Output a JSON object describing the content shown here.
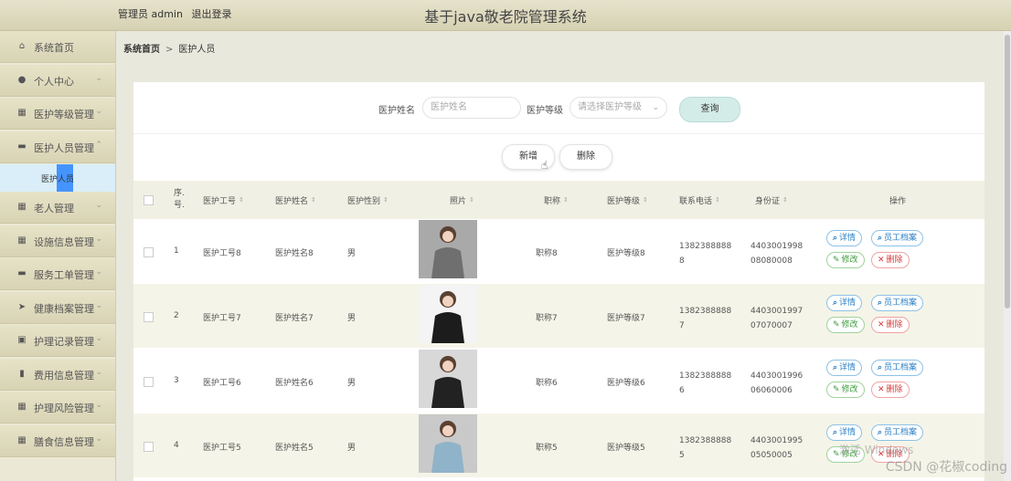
{
  "header": {
    "user_role": "管理员 admin",
    "logout": "退出登录",
    "title": "基于java敬老院管理系统"
  },
  "sidebar": {
    "items": [
      {
        "label": "系统首页",
        "icon": "home-icon",
        "glyph": "⌂",
        "expandable": false
      },
      {
        "label": "个人中心",
        "icon": "user-icon",
        "glyph": "●",
        "expandable": true
      },
      {
        "label": "医护等级管理",
        "icon": "grid-icon",
        "glyph": "▦",
        "expandable": true
      },
      {
        "label": "医护人员管理",
        "icon": "chat-icon",
        "glyph": "▬",
        "expandable": true,
        "expanded": true,
        "sub": [
          {
            "label": "医护人员"
          }
        ]
      },
      {
        "label": "老人管理",
        "icon": "grid-icon",
        "glyph": "▦",
        "expandable": true
      },
      {
        "label": "设施信息管理",
        "icon": "grid-icon",
        "glyph": "▦",
        "expandable": true
      },
      {
        "label": "服务工单管理",
        "icon": "monitor-icon",
        "glyph": "▬",
        "expandable": true
      },
      {
        "label": "健康档案管理",
        "icon": "send-icon",
        "glyph": "➤",
        "expandable": true
      },
      {
        "label": "护理记录管理",
        "icon": "doc-icon",
        "glyph": "▣",
        "expandable": true
      },
      {
        "label": "费用信息管理",
        "icon": "bar-chart-icon",
        "glyph": "▮",
        "expandable": true
      },
      {
        "label": "护理风险管理",
        "icon": "grid-icon",
        "glyph": "▦",
        "expandable": true
      },
      {
        "label": "膳食信息管理",
        "icon": "grid-icon",
        "glyph": "▦",
        "expandable": true
      }
    ]
  },
  "breadcrumb": {
    "home": "系统首页",
    "separator": ">",
    "current": "医护人员"
  },
  "search": {
    "name_label": "医护姓名",
    "name_placeholder": "医护姓名",
    "level_label": "医护等级",
    "level_placeholder": "请选择医护等级",
    "query_button": "查询"
  },
  "actions": {
    "add_button": "新增",
    "delete_button": "删除"
  },
  "table": {
    "columns": [
      "序号",
      "医护工号",
      "医护姓名",
      "医护性别",
      "照片",
      "职称",
      "医护等级",
      "联系电话",
      "身份证",
      "操作"
    ],
    "col_index_line1": "序.",
    "col_index_line2": "号.",
    "rows": [
      {
        "index": "1",
        "id": "医护工号8",
        "name": "医护姓名8",
        "gender": "男",
        "title": "职称8",
        "level": "医护等级8",
        "phone1": "1382388888",
        "phone2": "8",
        "idcard1": "4403001998",
        "idcard2": "08080008"
      },
      {
        "index": "2",
        "id": "医护工号7",
        "name": "医护姓名7",
        "gender": "男",
        "title": "职称7",
        "level": "医护等级7",
        "phone1": "1382388888",
        "phone2": "7",
        "idcard1": "4403001997",
        "idcard2": "07070007"
      },
      {
        "index": "3",
        "id": "医护工号6",
        "name": "医护姓名6",
        "gender": "男",
        "title": "职称6",
        "level": "医护等级6",
        "phone1": "1382388888",
        "phone2": "6",
        "idcard1": "4403001996",
        "idcard2": "06060006"
      },
      {
        "index": "4",
        "id": "医护工号5",
        "name": "医护姓名5",
        "gender": "男",
        "title": "职称5",
        "level": "医护等级5",
        "phone1": "1382388888",
        "phone2": "5",
        "idcard1": "4403001995",
        "idcard2": "05050005"
      }
    ],
    "ops": {
      "detail": "详情",
      "archive": "员工档案",
      "edit": "修改",
      "delete": "删除"
    }
  },
  "overlay": {
    "activate": "激活 Windows",
    "watermark": "CSDN @花椒coding"
  }
}
